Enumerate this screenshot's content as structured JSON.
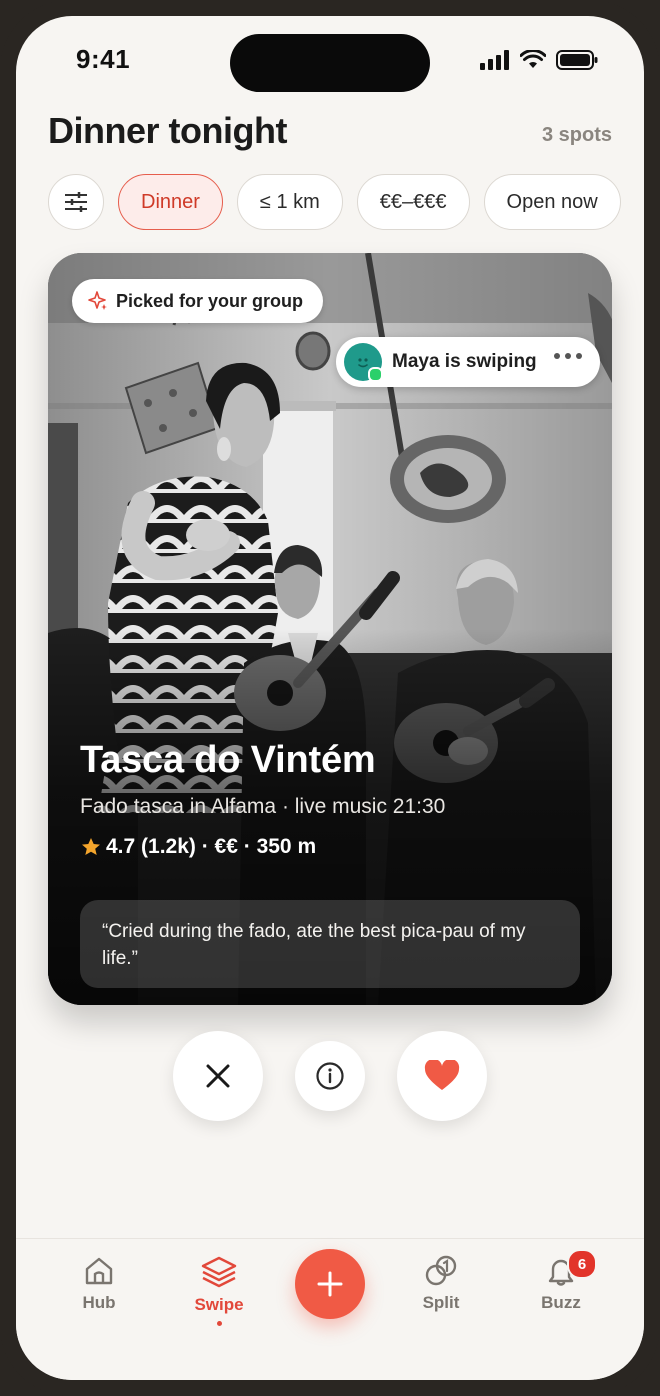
{
  "status_bar": {
    "time": "9:41"
  },
  "header": {
    "title": "Dinner tonight",
    "count": "3 spots"
  },
  "filters": {
    "chips": [
      {
        "label": "Dinner",
        "active": true
      },
      {
        "label": "≤ 1 km",
        "active": false
      },
      {
        "label": "€€–€€€",
        "active": false
      },
      {
        "label": "Open now",
        "active": false
      }
    ]
  },
  "card": {
    "badge": "Picked for your group",
    "swiper_text": "Maya is swiping",
    "name": "Tasca do Vintém",
    "description": "Fado tasca in Alfama · live music 21:30",
    "meta": "4.7 (1.2k) · €€ · 350 m",
    "quote": "“Cried during the fado, ate the best pica-pau of my life.”"
  },
  "tabs": [
    {
      "label": "Hub",
      "active": false
    },
    {
      "label": "Swipe",
      "active": true
    },
    {
      "label": "Split",
      "active": false
    },
    {
      "label": "Buzz",
      "active": false,
      "badge": "6"
    }
  ],
  "colors": {
    "accent": "#f05a45",
    "chip_active_bg": "#fdecea",
    "card_avatar": "#1f9a8b"
  }
}
